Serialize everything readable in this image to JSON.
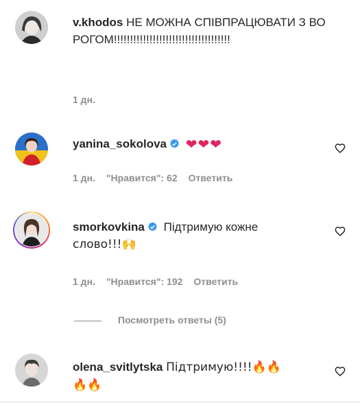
{
  "comments": [
    {
      "username": "v.khodos",
      "verified": false,
      "text": "НЕ МОЖНА СПІВПРАЦЮВАТИ З ВОРОГОМ!!!!!!!!!!!!!!!!!!!!!!!!!!!!!!!!!!!!",
      "time": "1 дн."
    },
    {
      "username": "yanina_sokolova",
      "verified": true,
      "text": "❤❤❤",
      "time": "1 дн.",
      "likes": "\"Нравится\": 62",
      "reply": "Ответить"
    },
    {
      "username": "smorkovkina",
      "verified": true,
      "text_line1": "Підтримую кожне",
      "text_line2": "слово!!!🙌",
      "time": "1 дн.",
      "likes": "\"Нравится\": 192",
      "reply": "Ответить"
    },
    {
      "username": "olena_svitlytska",
      "verified": false,
      "text": "Підтримую!!!!🔥🔥",
      "text_line2": "🔥🔥"
    }
  ],
  "view_replies": "Посмотреть ответы (5)",
  "colors": {
    "verified": "#3897f0",
    "heart": "#e0245e",
    "meta": "#8e8e8e"
  },
  "icons": {
    "like": "heart-outline-icon",
    "verified": "verified-badge-icon"
  }
}
